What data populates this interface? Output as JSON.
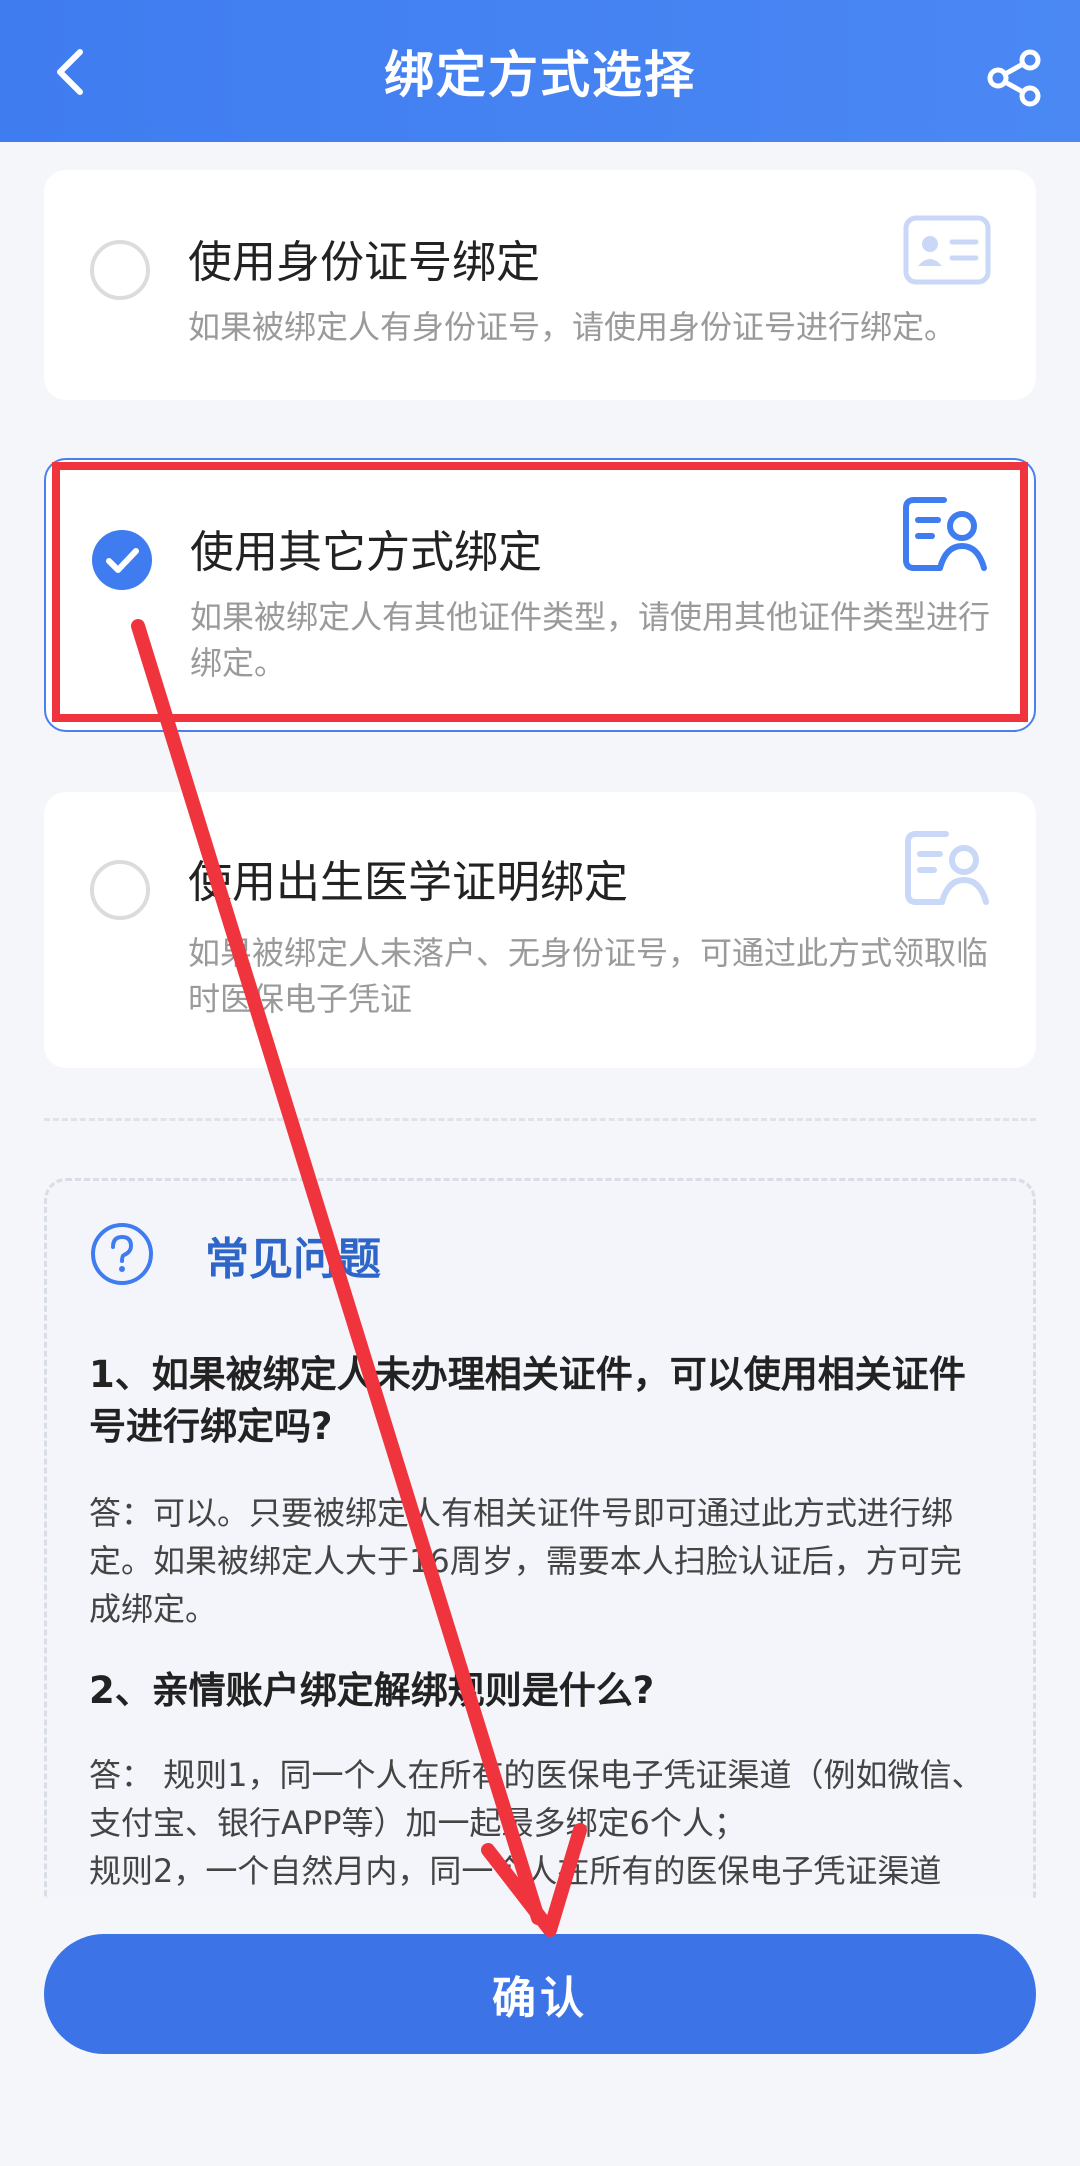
{
  "header": {
    "title": "绑定方式选择",
    "back_icon": "back-arrow-icon",
    "share_icon": "share-icon",
    "color": "#3f7cf0"
  },
  "options": [
    {
      "title": "使用身份证号绑定",
      "desc": "如果被绑定人有身份证号，请使用身份证号进行绑定。",
      "selected": false,
      "icon": "id-card-icon"
    },
    {
      "title": "使用其它方式绑定",
      "desc": "如果被绑定人有其他证件类型，请使用其他证件类型进行绑定。",
      "selected": true,
      "icon": "document-person-icon"
    },
    {
      "title": "使用出生医学证明绑定",
      "desc": "如果被绑定人未落户、无身份证号，可通过此方式领取临时医保电子凭证",
      "selected": false,
      "icon": "document-person-icon"
    }
  ],
  "faq": {
    "title": "常见问题",
    "icon": "question-circle-icon",
    "items": [
      {
        "q": "1、如果被绑定人未办理相关证件，可以使用相关证件号进行绑定吗?",
        "a": "答：可以。只要被绑定人有相关证件号即可通过此方式进行绑定。如果被绑定人大于16周岁，需要本人扫脸认证后，方可完成绑定。"
      },
      {
        "q": "2、亲情账户绑定解绑规则是什么?",
        "a": "答： 规则1，同一个人在所有的医保电子凭证渠道（例如微信、支付宝、银行APP等）加一起最多绑定6个人；",
        "a2": "规则2，一个自然月内，同一个人在所有的医保电子凭证渠道"
      }
    ]
  },
  "confirm": {
    "label": "确认"
  },
  "annotation": {
    "color": "#f0343e"
  }
}
